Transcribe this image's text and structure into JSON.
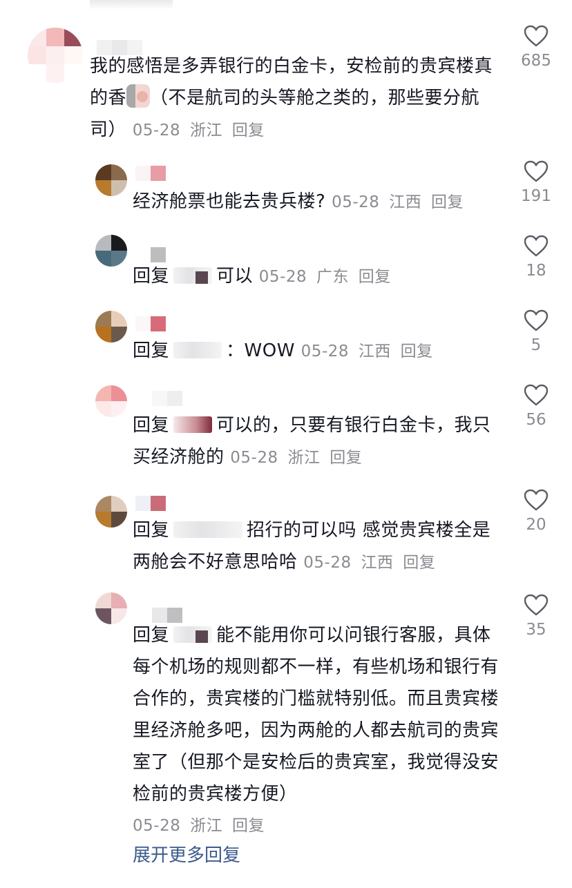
{
  "comments": [
    {
      "text": "我的感悟是多弄银行的白金卡，安检前的贵宾楼真的香",
      "text_after_emoji": "（不是航司的头等舱之类的，那些要分航司）",
      "emoji_name": "face-emoji",
      "date": "05-28",
      "location": "浙江",
      "reply_label": "回复",
      "likes": "685"
    }
  ],
  "replies": [
    {
      "prefix": "",
      "text": "经济舱票也能去贵兵楼?",
      "date": "05-28",
      "location": "江西",
      "reply_label": "回复",
      "likes": "191"
    },
    {
      "prefix": "回复",
      "text": "可以",
      "date": "05-28",
      "location": "广东",
      "reply_label": "回复",
      "likes": "18"
    },
    {
      "prefix": "回复",
      "text": "：WOW",
      "date": "05-28",
      "location": "江西",
      "reply_label": "回复",
      "likes": "5"
    },
    {
      "prefix": "回复",
      "text": "可以的，只要有银行白金卡，我只买经济舱的",
      "date": "05-28",
      "location": "浙江",
      "reply_label": "回复",
      "likes": "56"
    },
    {
      "prefix": "回复",
      "text": "招行的可以吗 感觉贵宾楼全是两舱会不好意思哈哈",
      "date": "05-28",
      "location": "江西",
      "reply_label": "回复",
      "likes": "20"
    },
    {
      "prefix": "回复",
      "text": "能不能用你可以问银行客服，具体每个机场的规则都不一样，有些机场和银行有合作的，贵宾楼的门槛就特别低。而且贵宾楼里经济舱多吧，因为两舱的人都去航司的贵宾室了（但那个是安检后的贵宾室，我觉得没安检前的贵宾楼方便）",
      "date": "05-28",
      "location": "浙江",
      "reply_label": "回复",
      "likes": "35"
    }
  ],
  "expand_more": "展开更多回复",
  "colors": {
    "text": "#161823",
    "meta": "#8a8b91",
    "link": "#3b5a8c",
    "icon": "#5b5c63"
  }
}
